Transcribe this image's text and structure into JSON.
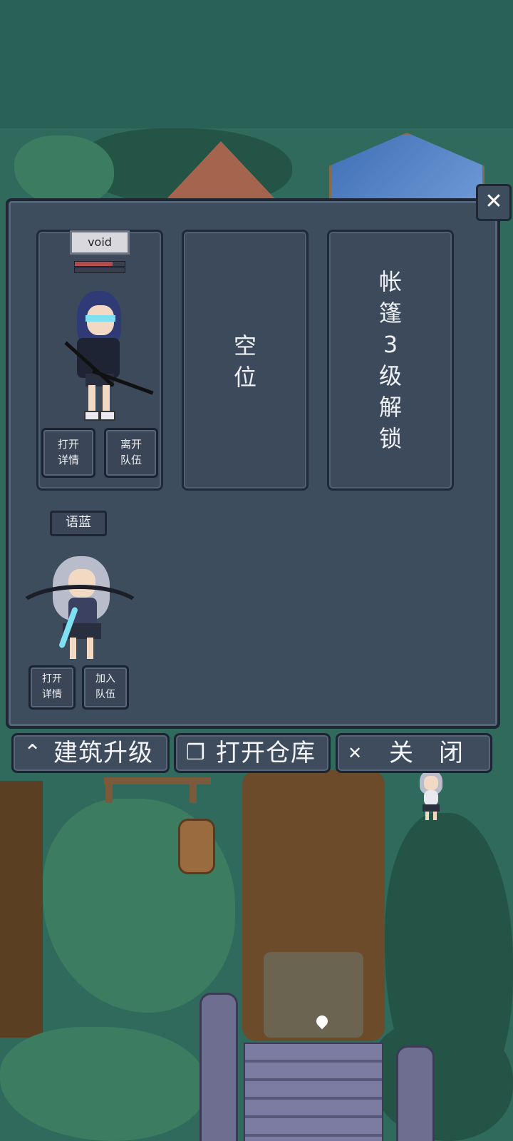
{
  "panel": {
    "close_icon": "close-icon",
    "slot1": {
      "name": "void",
      "hp_fraction": 0.75,
      "buttons": [
        {
          "line1": "打开",
          "line2": "详情"
        },
        {
          "line1": "离开",
          "line2": "队伍"
        }
      ]
    },
    "slot2": {
      "line1": "空",
      "line2": "位"
    },
    "slot3": {
      "lines": [
        "帐",
        "篷",
        "3",
        "级",
        "解",
        "锁"
      ]
    },
    "candidate": {
      "name": "语蓝",
      "buttons": [
        {
          "line1": "打开",
          "line2": "详情"
        },
        {
          "line1": "加入",
          "line2": "队伍"
        }
      ]
    }
  },
  "toolbar": {
    "upgrade": {
      "icon": "chevrons-up-icon",
      "label": "建筑升级"
    },
    "storage": {
      "icon": "boxes-icon",
      "label": "打开仓库"
    },
    "close": {
      "icon": "close-icon",
      "label": "关　闭"
    }
  },
  "colors": {
    "panel_bg": "#3e4d5e",
    "panel_border": "#1f2733",
    "text": "#eef0f4",
    "hp_fill": "#b24b4b"
  }
}
